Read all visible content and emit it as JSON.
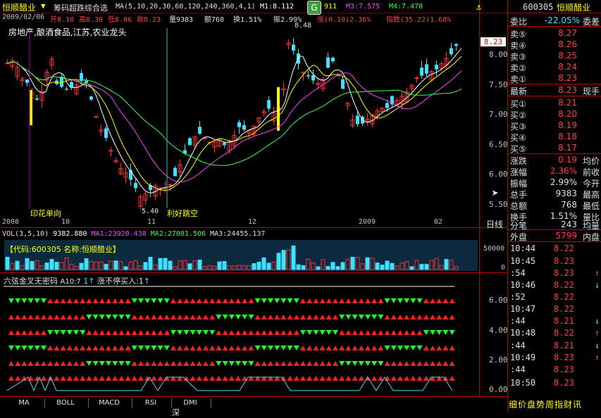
{
  "header": {
    "stock_name": "恒顺醋业",
    "indicator_name": "筹码超跌综合选",
    "ma_params": "MA(5,10,20,30,60,120,240,360,4,1)",
    "m1": "M1:8.112",
    "m2_tail": "911",
    "m3": "M3:7.575",
    "m4": "M4:7.470",
    "date": "2009/02/06",
    "open": "开8.10",
    "high": "高8.30",
    "low": "低8.06",
    "close": "收8.23",
    "vol": "量9383",
    "amount": "额768",
    "turnover": "换1.51%",
    "amplitude": "振2.99%",
    "change": "涨(0.19)2.36%",
    "index": "指数(35.22)1.68%",
    "g_icon_label": "G"
  },
  "main_chart": {
    "tags": "房地产,酿酒食品,江苏,农业龙头",
    "annotations": {
      "high_label": "8.48",
      "low_label": "5.40",
      "note_left": "印花单向",
      "note_right": "利好跳空"
    },
    "y_axis": [
      "8.00",
      "7.50",
      "7.00",
      "6.50",
      "6.00",
      "5.50"
    ],
    "price_tag": "8.23",
    "x_axis": [
      "2008",
      "10",
      "11",
      "12",
      "2009",
      "02"
    ],
    "x_unit": "日线"
  },
  "volume_panel": {
    "legend": {
      "vol": "VOL(3,5,10)",
      "v1": "9382.880",
      "ma1": "MA1:23920.438",
      "ma2": "MA2:27001.506",
      "ma3": "MA3:24455.137"
    },
    "info_box": "【代码:600305 名称:恒顺醋业】",
    "y_axis": [
      "50000",
      "0"
    ]
  },
  "signal_panel": {
    "legend": {
      "name": "六弦金叉无密码",
      "a10": "A10:7",
      "one": "1",
      "text": "涨不停买入:1"
    },
    "y_axis": [
      "6.00",
      "4.00",
      "2.00",
      "0.00"
    ]
  },
  "right_panel": {
    "code": "600305",
    "name": "恒顺醋业",
    "weibi_label": "委比",
    "weibi_value": "-22.05%",
    "weicha_label": "委差",
    "sells": [
      {
        "label": "卖⑤",
        "price": "8.27"
      },
      {
        "label": "卖④",
        "price": "8.26"
      },
      {
        "label": "卖③",
        "price": "8.25"
      },
      {
        "label": "卖②",
        "price": "8.24"
      },
      {
        "label": "卖①",
        "price": "8.23"
      }
    ],
    "latest_label": "最新",
    "latest_value": "8.23",
    "latest_right": "现手",
    "buys": [
      {
        "label": "买①",
        "price": "8.21"
      },
      {
        "label": "买②",
        "price": "8.20"
      },
      {
        "label": "买③",
        "price": "8.19"
      },
      {
        "label": "买④",
        "price": "8.18"
      },
      {
        "label": "买⑤",
        "price": "8.17"
      }
    ],
    "stats": [
      {
        "label": "涨跌",
        "value": "0.19",
        "right": "均价"
      },
      {
        "label": "涨幅",
        "value": "2.36%",
        "right": "前收"
      },
      {
        "label": "振幅",
        "value": "2.99%",
        "right": "今开"
      },
      {
        "label": "总手",
        "value": "9383",
        "right": "最高"
      },
      {
        "label": "总额",
        "value": "768",
        "right": "最低"
      },
      {
        "label": "换手",
        "value": "1.51%",
        "right": "量比"
      },
      {
        "label": "分笔",
        "value": "243",
        "right": "均量"
      }
    ],
    "outer_label": "外盘",
    "outer_value": "5799",
    "inner_label": "内盘",
    "ticks": [
      {
        "time": "10:44",
        "price": "8.22",
        "arrow": ""
      },
      {
        "time": "10:45",
        "price": "8.23",
        "arrow": ""
      },
      {
        "time": ":54",
        "price": "8.23",
        "arrow": "↑"
      },
      {
        "time": "10:46",
        "price": "8.22",
        "arrow": "↓"
      },
      {
        "time": ":52",
        "price": "8.22",
        "arrow": ""
      },
      {
        "time": "10:47",
        "price": "8.22",
        "arrow": ""
      },
      {
        "time": ":44",
        "price": "8.21",
        "arrow": "↓"
      },
      {
        "time": "10:48",
        "price": "8.22",
        "arrow": "↑"
      },
      {
        "time": ":44",
        "price": "8.21",
        "arrow": "↓"
      },
      {
        "time": "10:49",
        "price": "8.23",
        "arrow": "↑"
      },
      {
        "time": ":44",
        "price": "8.23",
        "arrow": ""
      },
      {
        "time": "10:50",
        "price": "8.23",
        "arrow": ""
      }
    ],
    "bottom_tabs": "细价盘势周指财讯"
  },
  "bottom_tabs": [
    "MA",
    "BOLL",
    "MACD",
    "RSI",
    "DMI"
  ],
  "status_fragment": "深",
  "colors": {
    "up": "#ff3030",
    "down": "#40e0ff",
    "frame": "#c00000",
    "highlight_yellow": "#ffff00"
  }
}
